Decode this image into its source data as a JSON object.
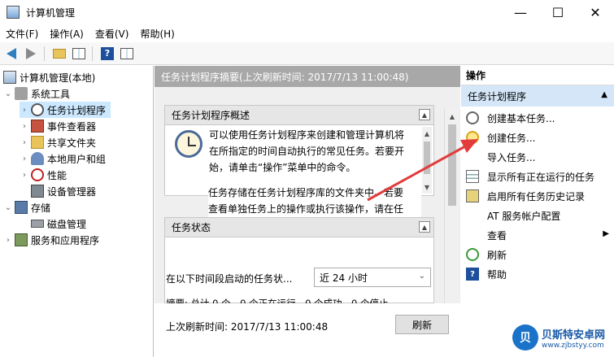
{
  "window": {
    "title": "计算机管理",
    "min": "—",
    "max": "☐",
    "close": "✕"
  },
  "menu": [
    "文件(F)",
    "操作(A)",
    "查看(V)",
    "帮助(H)"
  ],
  "tree": {
    "root": "计算机管理(本地)",
    "system_tools": "系统工具",
    "task_scheduler": "任务计划程序",
    "event_viewer": "事件查看器",
    "shared_folders": "共享文件夹",
    "local_users": "本地用户和组",
    "performance": "性能",
    "device_manager": "设备管理器",
    "storage": "存储",
    "disk_management": "磁盘管理",
    "services": "服务和应用程序"
  },
  "center": {
    "header": "任务计划程序摘要(上次刷新时间: 2017/7/13 11:00:48)",
    "overview_title": "任务计划程序概述",
    "overview_lines": [
      "可以使用任务计划程序来创建和管理计算机将",
      "在所指定的时间自动执行的常见任务。若要开",
      "始，请单击“操作”菜单中的命令。",
      "",
      "任务存储在任务计划程序库的文件夹中。若要",
      "查看单独任务上的操作或执行该操作，请在任"
    ],
    "status_title": "任务状态",
    "status_label": "在以下时间段启动的任务状...",
    "status_select": "近 24 小时",
    "summary": "摘要: 总计 0 个 - 0 个正在运行，0 个成功，0 个停止，...",
    "footer_text": "上次刷新时间: 2017/7/13 11:00:48",
    "refresh_button": "刷新"
  },
  "actions": {
    "header": "操作",
    "section": "任务计划程序",
    "items": [
      "创建基本任务...",
      "创建任务...",
      "导入任务...",
      "显示所有正在运行的任务",
      "启用所有任务历史记录",
      "AT 服务帐户配置",
      "查看",
      "刷新",
      "帮助"
    ]
  },
  "watermark": {
    "logo": "贝",
    "name": "贝斯特安卓网",
    "url": "www.zjbstyy.com"
  },
  "colors": {
    "accent": "#cce8ff",
    "action_section": "#d4e6f7",
    "annotation_arrow": "#e23b3b"
  }
}
